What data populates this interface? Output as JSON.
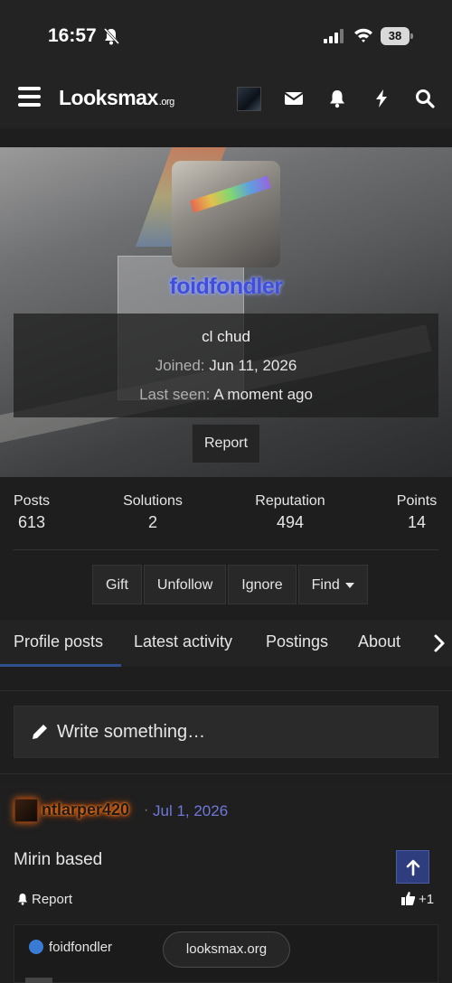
{
  "status_bar": {
    "time": "16:57",
    "battery": "38"
  },
  "nav": {
    "logo_main": "Looksmax",
    "logo_suffix": ".org"
  },
  "profile": {
    "username": "foidfondler",
    "title": "cl chud",
    "joined_label": "Joined:",
    "joined_value": "Jun 11, 2026",
    "last_seen_label": "Last seen:",
    "last_seen_value": "A moment ago",
    "report_label": "Report"
  },
  "stats": [
    {
      "label": "Posts",
      "value": "613"
    },
    {
      "label": "Solutions",
      "value": "2"
    },
    {
      "label": "Reputation",
      "value": "494"
    },
    {
      "label": "Points",
      "value": "14"
    }
  ],
  "actions": {
    "gift": "Gift",
    "unfollow": "Unfollow",
    "ignore": "Ignore",
    "find": "Find"
  },
  "tabs": [
    "Profile posts",
    "Latest activity",
    "Postings",
    "About"
  ],
  "write_placeholder": "Write something…",
  "post": {
    "author": "ntlarper420",
    "separator": "·",
    "date": "Jul 1, 2026",
    "body": "Mirin based",
    "report_label": "Report",
    "likes": "+1"
  },
  "comment": {
    "author": "foidfondler"
  },
  "url_pill": "looksmax.org",
  "colors": {
    "username": "#3f4fd9",
    "accent": "#2d3d7d",
    "date": "#6f78d8",
    "author_glow": "#ff7a18"
  }
}
